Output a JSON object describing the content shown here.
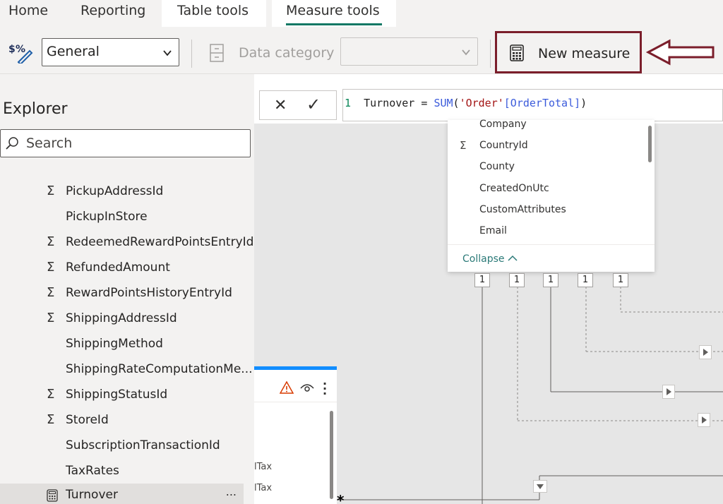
{
  "tabs": [
    {
      "label": "Home"
    },
    {
      "label": "Reporting"
    },
    {
      "label": "Table tools"
    },
    {
      "label": "Measure tools"
    }
  ],
  "ribbon": {
    "format_select_value": "General",
    "data_category_label": "Data category",
    "data_category_value": "",
    "new_measure_label": "New measure",
    "highlight_color": "#7b1e2b"
  },
  "explorer": {
    "title": "Explorer",
    "search_placeholder": "Search",
    "fields": [
      {
        "name": "PickupAddressId",
        "summable": true
      },
      {
        "name": "PickupInStore",
        "summable": false
      },
      {
        "name": "RedeemedRewardPointsEntryId",
        "summable": true
      },
      {
        "name": "RefundedAmount",
        "summable": true
      },
      {
        "name": "RewardPointsHistoryEntryId",
        "summable": true
      },
      {
        "name": "ShippingAddressId",
        "summable": true
      },
      {
        "name": "ShippingMethod",
        "summable": false
      },
      {
        "name": "ShippingRateComputationMe...",
        "summable": false
      },
      {
        "name": "ShippingStatusId",
        "summable": true
      },
      {
        "name": "StoreId",
        "summable": true
      },
      {
        "name": "SubscriptionTransactionId",
        "summable": false
      },
      {
        "name": "TaxRates",
        "summable": false
      },
      {
        "name": "Turnover",
        "summable": false,
        "selected": true,
        "more": "..."
      }
    ]
  },
  "formula": {
    "line_number": "1",
    "measure_name": "Turnover",
    "equals": "=",
    "function": "SUM",
    "arg_table": "'Order'",
    "arg_column": "[OrderTotal]",
    "close": ")"
  },
  "field_popup": {
    "items": [
      {
        "name": "Company",
        "summable": false
      },
      {
        "name": "CountryId",
        "summable": true
      },
      {
        "name": "County",
        "summable": false
      },
      {
        "name": "CreatedOnUtc",
        "summable": false
      },
      {
        "name": "CustomAttributes",
        "summable": false
      },
      {
        "name": "Email",
        "summable": false
      }
    ],
    "collapse_label": "Collapse"
  },
  "relationships": {
    "badges": [
      "1",
      "1",
      "1",
      "1",
      "1"
    ],
    "many_marker": "*"
  },
  "table_card": {
    "rows": [
      "lTax",
      "lTax"
    ]
  },
  "colors": {
    "accent": "#117865",
    "selection": "#118dff",
    "warning": "#d83b01"
  }
}
